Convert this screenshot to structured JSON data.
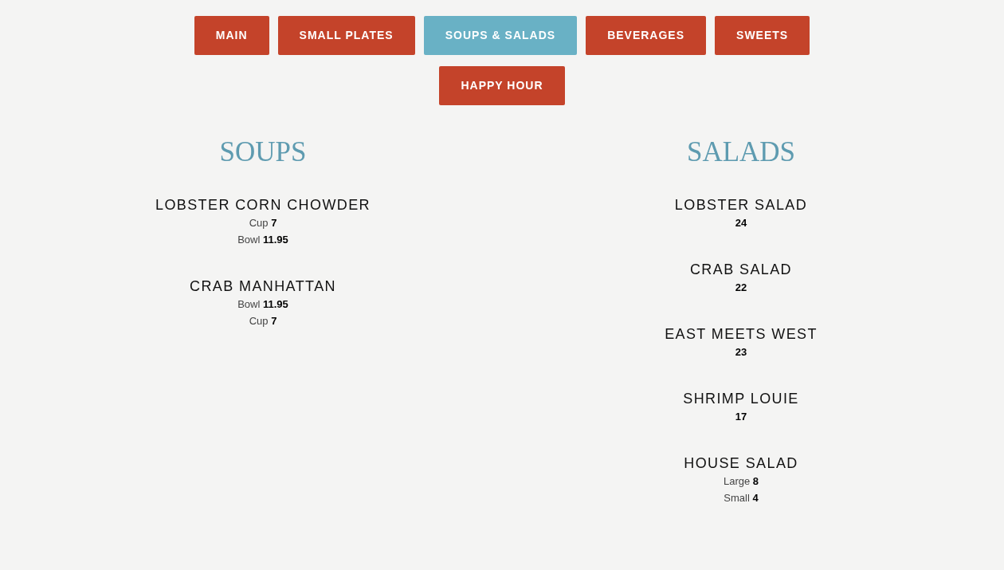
{
  "tabs": [
    {
      "label": "MAIN",
      "selected": false
    },
    {
      "label": "SMALL PLATES",
      "selected": false
    },
    {
      "label": "SOUPS & SALADS",
      "selected": true
    },
    {
      "label": "BEVERAGES",
      "selected": false
    },
    {
      "label": "SWEETS",
      "selected": false
    },
    {
      "label": "HAPPY HOUR",
      "selected": false
    }
  ],
  "sections": [
    {
      "title": "SOUPS",
      "items": [
        {
          "name": "LOBSTER CORN CHOWDER",
          "prices": [
            {
              "size": "Cup",
              "price": "7"
            },
            {
              "size": "Bowl",
              "price": "11.95"
            }
          ]
        },
        {
          "name": "CRAB MANHATTAN",
          "prices": [
            {
              "size": "Bowl",
              "price": "11.95"
            },
            {
              "size": "Cup",
              "price": "7"
            }
          ]
        }
      ]
    },
    {
      "title": "SALADS",
      "items": [
        {
          "name": "LOBSTER SALAD",
          "prices": [
            {
              "price": "24"
            }
          ]
        },
        {
          "name": "CRAB SALAD",
          "prices": [
            {
              "price": "22"
            }
          ]
        },
        {
          "name": "EAST MEETS WEST",
          "prices": [
            {
              "price": "23"
            }
          ]
        },
        {
          "name": "SHRIMP LOUIE",
          "prices": [
            {
              "price": "17"
            }
          ]
        },
        {
          "name": "HOUSE SALAD",
          "prices": [
            {
              "size": "Large",
              "price": "8"
            },
            {
              "size": "Small",
              "price": "4"
            }
          ]
        }
      ]
    }
  ]
}
